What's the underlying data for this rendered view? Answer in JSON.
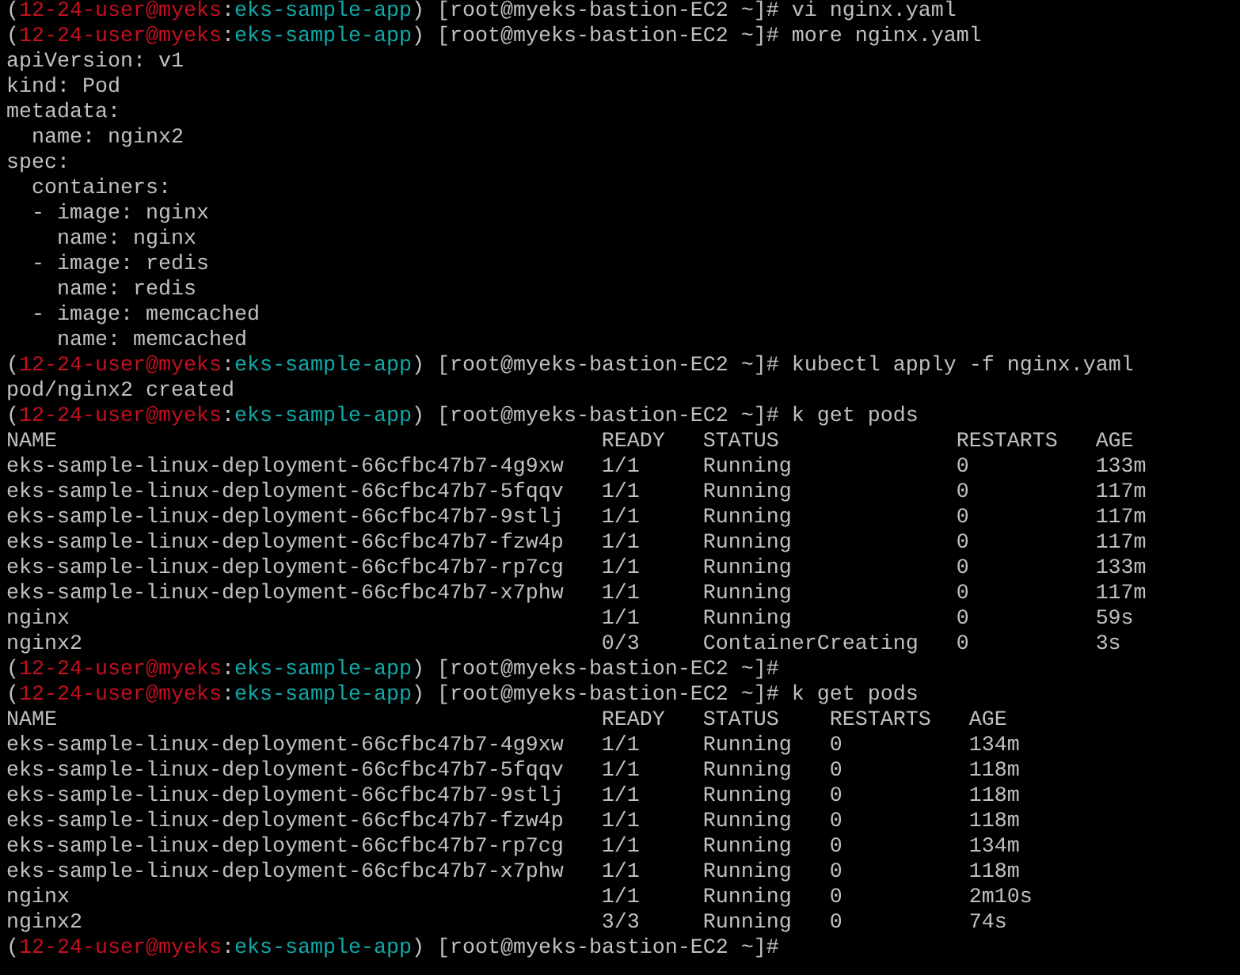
{
  "terminal": {
    "lines": [
      {
        "kind": "prompt",
        "parts": [
          {
            "kind": "plain",
            "text": "("
          },
          {
            "kind": "user",
            "text": "12-24-user@myeks"
          },
          {
            "kind": "plain",
            "text": ":"
          },
          {
            "kind": "context",
            "text": "eks-sample-app"
          },
          {
            "kind": "plain",
            "text": ") [root@myeks-bastion-EC2 ~]#"
          }
        ],
        "command": "vi nginx.yaml"
      },
      {
        "kind": "prompt",
        "parts": [
          {
            "kind": "plain",
            "text": "("
          },
          {
            "kind": "user",
            "text": "12-24-user@myeks"
          },
          {
            "kind": "plain",
            "text": ":"
          },
          {
            "kind": "context",
            "text": "eks-sample-app"
          },
          {
            "kind": "plain",
            "text": ") [root@myeks-bastion-EC2 ~]#"
          }
        ],
        "command": "more nginx.yaml"
      },
      {
        "kind": "output",
        "text": "apiVersion: v1"
      },
      {
        "kind": "output",
        "text": "kind: Pod"
      },
      {
        "kind": "output",
        "text": "metadata:"
      },
      {
        "kind": "output",
        "text": "  name: nginx2"
      },
      {
        "kind": "output",
        "text": "spec:"
      },
      {
        "kind": "output",
        "text": "  containers:"
      },
      {
        "kind": "output",
        "text": "  - image: nginx"
      },
      {
        "kind": "output",
        "text": "    name: nginx"
      },
      {
        "kind": "output",
        "text": "  - image: redis"
      },
      {
        "kind": "output",
        "text": "    name: redis"
      },
      {
        "kind": "output",
        "text": "  - image: memcached"
      },
      {
        "kind": "output",
        "text": "    name: memcached"
      },
      {
        "kind": "prompt",
        "parts": [
          {
            "kind": "plain",
            "text": "("
          },
          {
            "kind": "user",
            "text": "12-24-user@myeks"
          },
          {
            "kind": "plain",
            "text": ":"
          },
          {
            "kind": "context",
            "text": "eks-sample-app"
          },
          {
            "kind": "plain",
            "text": ") [root@myeks-bastion-EC2 ~]#"
          }
        ],
        "command": "kubectl apply -f nginx.yaml"
      },
      {
        "kind": "output",
        "text": "pod/nginx2 created"
      },
      {
        "kind": "prompt",
        "parts": [
          {
            "kind": "plain",
            "text": "("
          },
          {
            "kind": "user",
            "text": "12-24-user@myeks"
          },
          {
            "kind": "plain",
            "text": ":"
          },
          {
            "kind": "context",
            "text": "eks-sample-app"
          },
          {
            "kind": "plain",
            "text": ") [root@myeks-bastion-EC2 ~]#"
          }
        ],
        "command": "k get pods"
      },
      {
        "kind": "table",
        "columns": [
          "NAME",
          "READY",
          "STATUS",
          "RESTARTS",
          "AGE"
        ],
        "rows": [
          [
            "eks-sample-linux-deployment-66cfbc47b7-4g9xw",
            "1/1",
            "Running",
            "0",
            "133m"
          ],
          [
            "eks-sample-linux-deployment-66cfbc47b7-5fqqv",
            "1/1",
            "Running",
            "0",
            "117m"
          ],
          [
            "eks-sample-linux-deployment-66cfbc47b7-9stlj",
            "1/1",
            "Running",
            "0",
            "117m"
          ],
          [
            "eks-sample-linux-deployment-66cfbc47b7-fzw4p",
            "1/1",
            "Running",
            "0",
            "117m"
          ],
          [
            "eks-sample-linux-deployment-66cfbc47b7-rp7cg",
            "1/1",
            "Running",
            "0",
            "133m"
          ],
          [
            "eks-sample-linux-deployment-66cfbc47b7-x7phw",
            "1/1",
            "Running",
            "0",
            "117m"
          ],
          [
            "nginx",
            "1/1",
            "Running",
            "0",
            "59s"
          ],
          [
            "nginx2",
            "0/3",
            "ContainerCreating",
            "0",
            "3s"
          ]
        ]
      },
      {
        "kind": "prompt",
        "parts": [
          {
            "kind": "plain",
            "text": "("
          },
          {
            "kind": "user",
            "text": "12-24-user@myeks"
          },
          {
            "kind": "plain",
            "text": ":"
          },
          {
            "kind": "context",
            "text": "eks-sample-app"
          },
          {
            "kind": "plain",
            "text": ") [root@myeks-bastion-EC2 ~]#"
          }
        ]
      },
      {
        "kind": "prompt",
        "parts": [
          {
            "kind": "plain",
            "text": "("
          },
          {
            "kind": "user",
            "text": "12-24-user@myeks"
          },
          {
            "kind": "plain",
            "text": ":"
          },
          {
            "kind": "context",
            "text": "eks-sample-app"
          },
          {
            "kind": "plain",
            "text": ") [root@myeks-bastion-EC2 ~]#"
          }
        ],
        "command": "k get pods"
      },
      {
        "kind": "table",
        "columns": [
          "NAME",
          "READY",
          "STATUS",
          "RESTARTS",
          "AGE"
        ],
        "rows": [
          [
            "eks-sample-linux-deployment-66cfbc47b7-4g9xw",
            "1/1",
            "Running",
            "0",
            "134m"
          ],
          [
            "eks-sample-linux-deployment-66cfbc47b7-5fqqv",
            "1/1",
            "Running",
            "0",
            "118m"
          ],
          [
            "eks-sample-linux-deployment-66cfbc47b7-9stlj",
            "1/1",
            "Running",
            "0",
            "118m"
          ],
          [
            "eks-sample-linux-deployment-66cfbc47b7-fzw4p",
            "1/1",
            "Running",
            "0",
            "118m"
          ],
          [
            "eks-sample-linux-deployment-66cfbc47b7-rp7cg",
            "1/1",
            "Running",
            "0",
            "134m"
          ],
          [
            "eks-sample-linux-deployment-66cfbc47b7-x7phw",
            "1/1",
            "Running",
            "0",
            "118m"
          ],
          [
            "nginx",
            "1/1",
            "Running",
            "0",
            "2m10s"
          ],
          [
            "nginx2",
            "3/3",
            "Running",
            "0",
            "74s"
          ]
        ]
      },
      {
        "kind": "prompt",
        "parts": [
          {
            "kind": "plain",
            "text": "("
          },
          {
            "kind": "user",
            "text": "12-24-user@myeks"
          },
          {
            "kind": "plain",
            "text": ":"
          },
          {
            "kind": "context",
            "text": "eks-sample-app"
          },
          {
            "kind": "plain",
            "text": ") [root@myeks-bastion-EC2 ~]#"
          }
        ]
      }
    ]
  }
}
